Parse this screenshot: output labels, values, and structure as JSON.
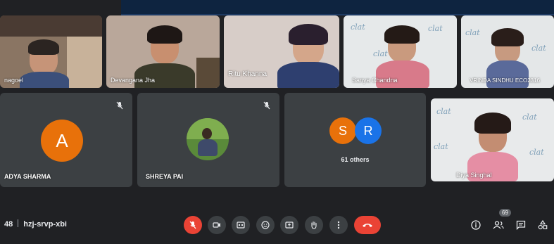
{
  "participants_row1": [
    {
      "name": "nagoel"
    },
    {
      "name": "Devangana Jha"
    },
    {
      "name": "Ritu Khanna"
    },
    {
      "name": "Sanya Chandna"
    },
    {
      "name": "VRINDA SINDHU ECO2316"
    }
  ],
  "participants_row2": [
    {
      "name": "ADYA SHARMA",
      "initial": "A",
      "avatar_color": "#e8710a"
    },
    {
      "name": "SHREYA PAI"
    },
    {
      "others_label": "61 others",
      "initials": [
        "S",
        "R"
      ],
      "colors": [
        "#e8710a",
        "#1a73e8"
      ]
    },
    {
      "name": "Diya Singhal"
    }
  ],
  "meeting": {
    "time_fragment": "48",
    "code": "hzj-srvp-xbi"
  },
  "participant_count": "69",
  "colors": {
    "background": "#202124",
    "tile": "#3c4043",
    "end_call": "#ea4335"
  },
  "controls": [
    "mic-off-icon",
    "camera-icon",
    "captions-icon",
    "emoji-icon",
    "present-icon",
    "raise-hand-icon",
    "more-options-icon",
    "end-call-icon"
  ],
  "right_controls": [
    "info-icon",
    "people-icon",
    "chat-icon",
    "activities-icon"
  ]
}
